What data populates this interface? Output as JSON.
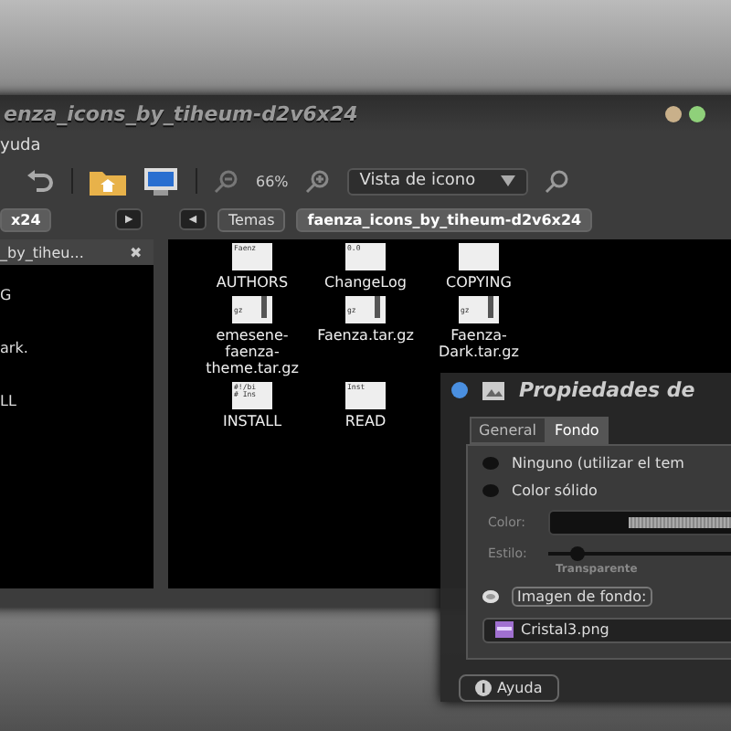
{
  "window": {
    "title": "enza_icons_by_tiheum-d2v6x24"
  },
  "menu": [
    "yuda"
  ],
  "toolbar": {
    "zoom": "66%",
    "view": "Vista de icono"
  },
  "left_pane": {
    "path_tab": "x24",
    "forward": "►",
    "title": "_by_tiheu...",
    "close": "✖",
    "items": [
      "G",
      "ark.",
      "LL"
    ]
  },
  "path_bar": {
    "back": "◄",
    "crumbs": [
      {
        "label": "Temas",
        "selected": false
      },
      {
        "label": "faenza_icons_by_tiheum-d2v6x24",
        "selected": true
      }
    ]
  },
  "files": [
    {
      "name": "AUTHORS",
      "kind": "text",
      "preview": "Faenz"
    },
    {
      "name": "ChangeLog",
      "kind": "text",
      "preview": "0.0"
    },
    {
      "name": "COPYING",
      "kind": "text"
    },
    {
      "name": "emesene-faenza-theme.tar.gz",
      "kind": "archive",
      "preview": "gz"
    },
    {
      "name": "Faenza.tar.gz",
      "kind": "archive",
      "preview": "gz"
    },
    {
      "name": "Faenza-Dark.tar.gz",
      "kind": "archive",
      "preview": "gz"
    },
    {
      "name": "INSTALL",
      "kind": "text",
      "preview": "#!/bi # Ins"
    },
    {
      "name": "READ",
      "kind": "text",
      "preview": "Inst"
    }
  ],
  "dialog": {
    "title": "Propiedades de",
    "tabs": [
      {
        "label": "General",
        "selected": false
      },
      {
        "label": "Fondo",
        "selected": true
      }
    ],
    "options": [
      {
        "kind": "radio",
        "label": "Ninguno (utilizar el tem",
        "selected": false
      },
      {
        "kind": "radio",
        "label": "Color sólido",
        "selected": false
      },
      {
        "kind": "color",
        "label": "Color:"
      },
      {
        "kind": "slider",
        "label": "Estilo:",
        "level": 0.15,
        "caption": "Transparente"
      },
      {
        "kind": "radio",
        "label": "Imagen de fondo:",
        "selected": true
      },
      {
        "kind": "file",
        "label": "Cristal3.png"
      }
    ],
    "help": "Ayuda"
  }
}
